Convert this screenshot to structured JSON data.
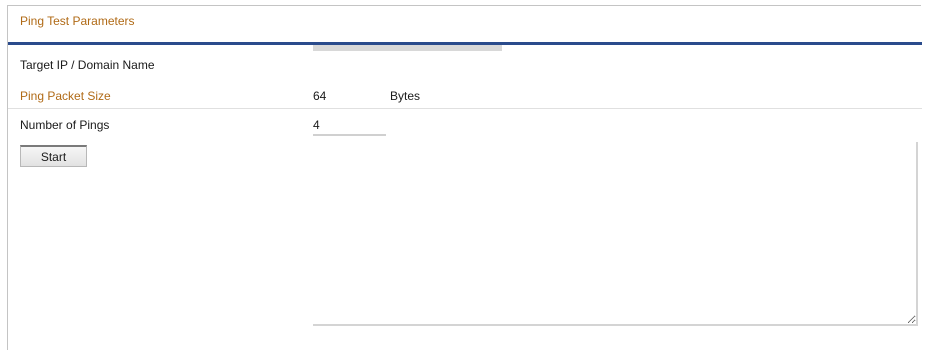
{
  "panel": {
    "title": "Ping Test Parameters"
  },
  "fields": {
    "target_label": "Target IP / Domain Name",
    "target_value": "",
    "packet_size_label": "Ping Packet Size",
    "packet_size_value": "64",
    "packet_size_unit": "Bytes",
    "count_label": "Number of Pings",
    "count_value": "4"
  },
  "actions": {
    "start_label": "Start"
  },
  "result": {
    "text": ""
  },
  "colors": {
    "accent_bar": "#2a4b8c",
    "label_orange": "#b06a16"
  }
}
